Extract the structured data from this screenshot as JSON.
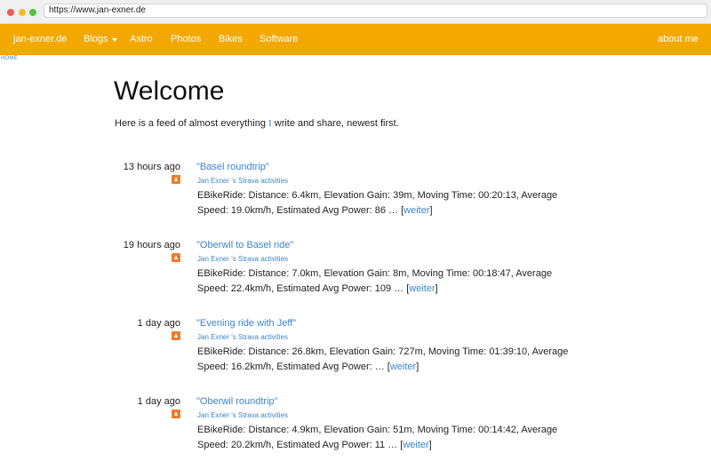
{
  "browser": {
    "url": "https://www.jan-exner.de"
  },
  "nav": {
    "brand": "jan-exner.de",
    "blogs": "Blogs",
    "astro": "Astro",
    "photos": "Photos",
    "bikes": "Bikes",
    "software": "Software",
    "about": "about me"
  },
  "breadcrumb": "HOME",
  "page": {
    "title": "Welcome",
    "intro_before": "Here is a feed of almost everything ",
    "intro_glyph": "I",
    "intro_after": " write and share, newest first."
  },
  "entries": [
    {
      "time": "13 hours ago",
      "title": "\"Basel roundtrip\"",
      "source": "Jan Exner 's Strava activities",
      "desc": "EBikeRide: Distance: 6.4km, Elevation Gain: 39m, Moving Time: 00:20:13, Average Speed: 19.0km/h, Estimated Avg Power: 86 … [",
      "more": "weiter",
      "close": "]"
    },
    {
      "time": "19 hours ago",
      "title": "\"Oberwil to Basel ride\"",
      "source": "Jan Exner 's Strava activities",
      "desc": "EBikeRide: Distance: 7.0km, Elevation Gain: 8m, Moving Time: 00:18:47, Average Speed: 22.4km/h, Estimated Avg Power: 109 … [",
      "more": "weiter",
      "close": "]"
    },
    {
      "time": "1 day ago",
      "title": "\"Evening ride with Jeff\"",
      "source": "Jan Exner 's Strava activities",
      "desc": "EBikeRide: Distance: 26.8km, Elevation Gain: 727m, Moving Time: 01:39:10, Average Speed: 16.2km/h, Estimated Avg Power: … [",
      "more": "weiter",
      "close": "]"
    },
    {
      "time": "1 day ago",
      "title": "\"Oberwil roundtrip\"",
      "source": "Jan Exner 's Strava activities",
      "desc": "EBikeRide: Distance: 4.9km, Elevation Gain: 51m, Moving Time: 00:14:42, Average Speed: 20.2km/h, Estimated Avg Power: 11 … [",
      "more": "weiter",
      "close": "]"
    }
  ]
}
